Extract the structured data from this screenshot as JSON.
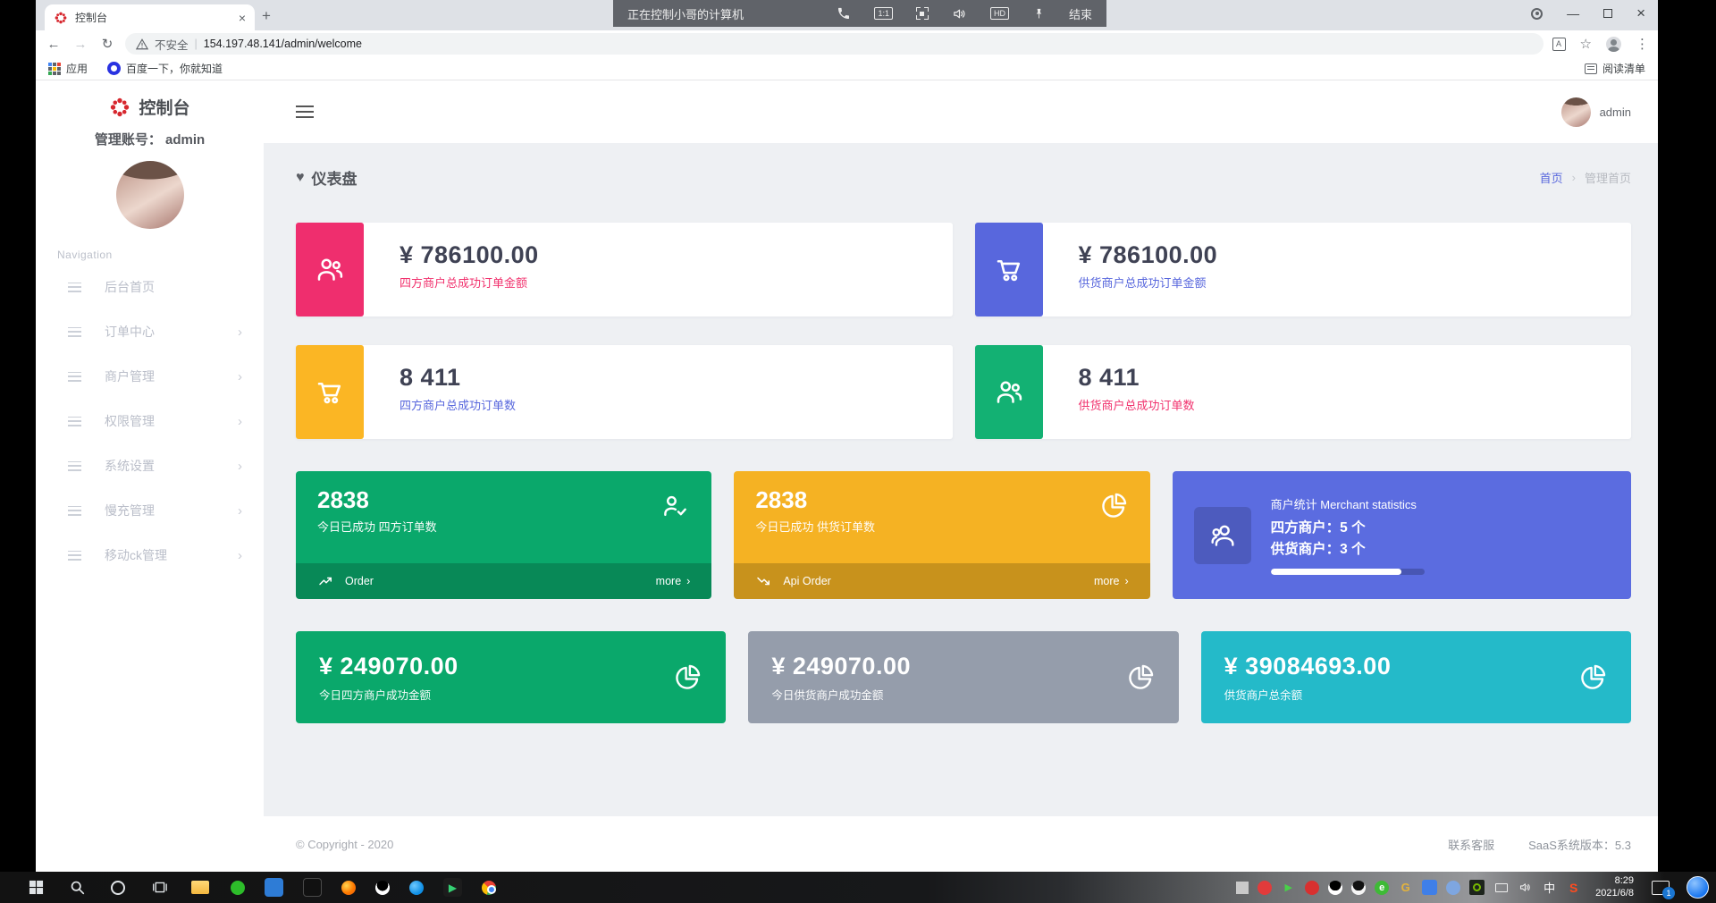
{
  "colors": {
    "accent_pink": "#ef2e6e",
    "accent_blue": "#5867dd",
    "accent_yellow": "#fbb624",
    "accent_green": "#0aa86b",
    "accent_gray": "#959dab",
    "accent_teal": "#24bac9",
    "merchant_blue": "#5b6ce0",
    "logo_red": "#d7282f"
  },
  "remote_bar": {
    "title": "正在控制小哥的计算机",
    "ratio_label": "1:1",
    "hd_label": "HD",
    "end_label": "结束"
  },
  "browser": {
    "tab_title": "控制台",
    "security_label": "不安全",
    "url": "154.197.48.141/admin/welcome",
    "bookmarks_apps_label": "应用",
    "bookmarks_baidu_label": "百度一下，你就知道",
    "reading_list_label": "阅读清单"
  },
  "sidebar": {
    "logo_title": "控制台",
    "account_label": "管理账号：",
    "account_name": "admin",
    "nav_caption": "Navigation",
    "items": [
      {
        "label": "后台首页"
      },
      {
        "label": "订单中心"
      },
      {
        "label": "商户管理"
      },
      {
        "label": "权限管理"
      },
      {
        "label": "系统设置"
      },
      {
        "label": "慢充管理"
      },
      {
        "label": "移动ck管理"
      }
    ]
  },
  "topbar": {
    "username": "admin"
  },
  "page": {
    "title": "仪表盘",
    "breadcrumb_home": "首页",
    "breadcrumb_current": "管理首页",
    "stat_cards": [
      {
        "value": "¥ 786100.00",
        "label": "四方商户总成功订单金额",
        "icon": "users-icon",
        "accent": "#ef2e6e"
      },
      {
        "value": "¥ 786100.00",
        "label": "供货商户总成功订单金额",
        "icon": "cart-icon",
        "accent": "#5867dd"
      },
      {
        "value": "8 411",
        "label": "四方商户总成功订单数",
        "icon": "cart-icon",
        "accent": "#fbb624"
      },
      {
        "value": "8 411",
        "label": "供货商户总成功订单数",
        "icon": "users-icon",
        "accent": "#13b173"
      }
    ],
    "order_cards": [
      {
        "value": "2838",
        "label": "今日已成功 四方订单数",
        "footer_label": "Order",
        "more_label": "more"
      },
      {
        "value": "2838",
        "label": "今日已成功 供货订单数",
        "footer_label": "Api Order",
        "more_label": "more"
      }
    ],
    "merchant_card": {
      "title": "商户统计 Merchant statistics",
      "line1": "四方商户：5 个",
      "line2": "供货商户：3 个",
      "progress_percent": 85
    },
    "amount_cards": [
      {
        "value": "¥ 249070.00",
        "label": "今日四方商户成功金额"
      },
      {
        "value": "¥ 249070.00",
        "label": "今日供货商户成功金额"
      },
      {
        "value": "¥ 39084693.00",
        "label": "供货商户总余额"
      }
    ],
    "footer": {
      "copyright": "© Copyright - 2020",
      "contact": "联系客服",
      "version": "SaaS系统版本：5.3"
    }
  },
  "taskbar": {
    "ime_label": "中",
    "clock_time": "8:29",
    "clock_date": "2021/6/8",
    "notification_count": "1",
    "green_e_label": "e",
    "gold_g_label": "G",
    "sogou_label": "S"
  },
  "glyphs": {
    "close": "×",
    "minimize": "—",
    "plus": "+",
    "back": "←",
    "forward": "→",
    "reload": "↻",
    "star": "☆",
    "menu_dots": "⋮",
    "chevron": "›",
    "heart": "♥",
    "pipe": "|"
  }
}
